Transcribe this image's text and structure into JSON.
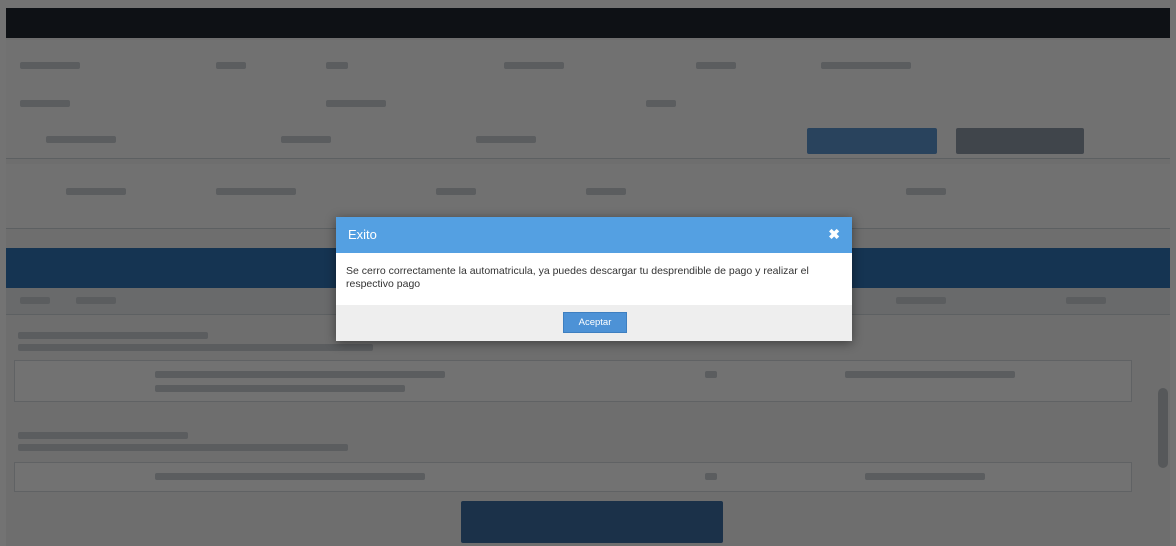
{
  "modal": {
    "title": "Exito",
    "close_glyph": "✖",
    "message": "Se cerro correctamente la automatricula, ya puedes descargar tu desprendible de pago y realizar el respectivo pago",
    "accept_label": "Aceptar"
  },
  "colors": {
    "modal_header": "#54a0e2",
    "accept_button": "#4d92d6",
    "overlay": "rgba(0,0,0,0.55)",
    "top_bar": "#1f2630",
    "section_bar": "#2f73b5"
  }
}
